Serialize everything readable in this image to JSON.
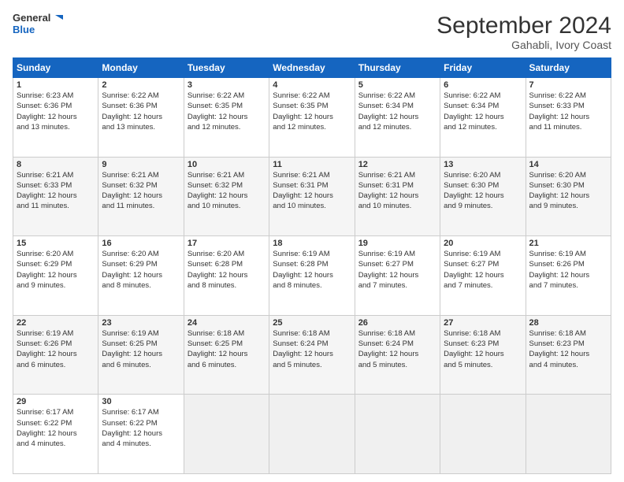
{
  "header": {
    "logo_line1": "General",
    "logo_line2": "Blue",
    "title": "September 2024",
    "subtitle": "Gahabli, Ivory Coast"
  },
  "calendar": {
    "columns": [
      "Sunday",
      "Monday",
      "Tuesday",
      "Wednesday",
      "Thursday",
      "Friday",
      "Saturday"
    ],
    "rows": [
      [
        {
          "day": "1",
          "lines": [
            "Sunrise: 6:23 AM",
            "Sunset: 6:36 PM",
            "Daylight: 12 hours",
            "and 13 minutes."
          ]
        },
        {
          "day": "2",
          "lines": [
            "Sunrise: 6:22 AM",
            "Sunset: 6:36 PM",
            "Daylight: 12 hours",
            "and 13 minutes."
          ]
        },
        {
          "day": "3",
          "lines": [
            "Sunrise: 6:22 AM",
            "Sunset: 6:35 PM",
            "Daylight: 12 hours",
            "and 12 minutes."
          ]
        },
        {
          "day": "4",
          "lines": [
            "Sunrise: 6:22 AM",
            "Sunset: 6:35 PM",
            "Daylight: 12 hours",
            "and 12 minutes."
          ]
        },
        {
          "day": "5",
          "lines": [
            "Sunrise: 6:22 AM",
            "Sunset: 6:34 PM",
            "Daylight: 12 hours",
            "and 12 minutes."
          ]
        },
        {
          "day": "6",
          "lines": [
            "Sunrise: 6:22 AM",
            "Sunset: 6:34 PM",
            "Daylight: 12 hours",
            "and 12 minutes."
          ]
        },
        {
          "day": "7",
          "lines": [
            "Sunrise: 6:22 AM",
            "Sunset: 6:33 PM",
            "Daylight: 12 hours",
            "and 11 minutes."
          ]
        }
      ],
      [
        {
          "day": "8",
          "lines": [
            "Sunrise: 6:21 AM",
            "Sunset: 6:33 PM",
            "Daylight: 12 hours",
            "and 11 minutes."
          ]
        },
        {
          "day": "9",
          "lines": [
            "Sunrise: 6:21 AM",
            "Sunset: 6:32 PM",
            "Daylight: 12 hours",
            "and 11 minutes."
          ]
        },
        {
          "day": "10",
          "lines": [
            "Sunrise: 6:21 AM",
            "Sunset: 6:32 PM",
            "Daylight: 12 hours",
            "and 10 minutes."
          ]
        },
        {
          "day": "11",
          "lines": [
            "Sunrise: 6:21 AM",
            "Sunset: 6:31 PM",
            "Daylight: 12 hours",
            "and 10 minutes."
          ]
        },
        {
          "day": "12",
          "lines": [
            "Sunrise: 6:21 AM",
            "Sunset: 6:31 PM",
            "Daylight: 12 hours",
            "and 10 minutes."
          ]
        },
        {
          "day": "13",
          "lines": [
            "Sunrise: 6:20 AM",
            "Sunset: 6:30 PM",
            "Daylight: 12 hours",
            "and 9 minutes."
          ]
        },
        {
          "day": "14",
          "lines": [
            "Sunrise: 6:20 AM",
            "Sunset: 6:30 PM",
            "Daylight: 12 hours",
            "and 9 minutes."
          ]
        }
      ],
      [
        {
          "day": "15",
          "lines": [
            "Sunrise: 6:20 AM",
            "Sunset: 6:29 PM",
            "Daylight: 12 hours",
            "and 9 minutes."
          ]
        },
        {
          "day": "16",
          "lines": [
            "Sunrise: 6:20 AM",
            "Sunset: 6:29 PM",
            "Daylight: 12 hours",
            "and 8 minutes."
          ]
        },
        {
          "day": "17",
          "lines": [
            "Sunrise: 6:20 AM",
            "Sunset: 6:28 PM",
            "Daylight: 12 hours",
            "and 8 minutes."
          ]
        },
        {
          "day": "18",
          "lines": [
            "Sunrise: 6:19 AM",
            "Sunset: 6:28 PM",
            "Daylight: 12 hours",
            "and 8 minutes."
          ]
        },
        {
          "day": "19",
          "lines": [
            "Sunrise: 6:19 AM",
            "Sunset: 6:27 PM",
            "Daylight: 12 hours",
            "and 7 minutes."
          ]
        },
        {
          "day": "20",
          "lines": [
            "Sunrise: 6:19 AM",
            "Sunset: 6:27 PM",
            "Daylight: 12 hours",
            "and 7 minutes."
          ]
        },
        {
          "day": "21",
          "lines": [
            "Sunrise: 6:19 AM",
            "Sunset: 6:26 PM",
            "Daylight: 12 hours",
            "and 7 minutes."
          ]
        }
      ],
      [
        {
          "day": "22",
          "lines": [
            "Sunrise: 6:19 AM",
            "Sunset: 6:26 PM",
            "Daylight: 12 hours",
            "and 6 minutes."
          ]
        },
        {
          "day": "23",
          "lines": [
            "Sunrise: 6:19 AM",
            "Sunset: 6:25 PM",
            "Daylight: 12 hours",
            "and 6 minutes."
          ]
        },
        {
          "day": "24",
          "lines": [
            "Sunrise: 6:18 AM",
            "Sunset: 6:25 PM",
            "Daylight: 12 hours",
            "and 6 minutes."
          ]
        },
        {
          "day": "25",
          "lines": [
            "Sunrise: 6:18 AM",
            "Sunset: 6:24 PM",
            "Daylight: 12 hours",
            "and 5 minutes."
          ]
        },
        {
          "day": "26",
          "lines": [
            "Sunrise: 6:18 AM",
            "Sunset: 6:24 PM",
            "Daylight: 12 hours",
            "and 5 minutes."
          ]
        },
        {
          "day": "27",
          "lines": [
            "Sunrise: 6:18 AM",
            "Sunset: 6:23 PM",
            "Daylight: 12 hours",
            "and 5 minutes."
          ]
        },
        {
          "day": "28",
          "lines": [
            "Sunrise: 6:18 AM",
            "Sunset: 6:23 PM",
            "Daylight: 12 hours",
            "and 4 minutes."
          ]
        }
      ],
      [
        {
          "day": "29",
          "lines": [
            "Sunrise: 6:17 AM",
            "Sunset: 6:22 PM",
            "Daylight: 12 hours",
            "and 4 minutes."
          ]
        },
        {
          "day": "30",
          "lines": [
            "Sunrise: 6:17 AM",
            "Sunset: 6:22 PM",
            "Daylight: 12 hours",
            "and 4 minutes."
          ]
        },
        null,
        null,
        null,
        null,
        null
      ]
    ]
  }
}
